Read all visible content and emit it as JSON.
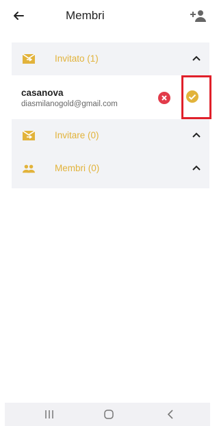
{
  "header": {
    "title": "Membri",
    "back_icon": "arrow-left-icon",
    "add_icon": "add-person-icon"
  },
  "sections": [
    {
      "label": "Invitato (1)",
      "icon": "mail-arrow-icon",
      "expanded": true
    },
    {
      "label": "Invitare (0)",
      "icon": "mail-forward-icon",
      "expanded": true
    },
    {
      "label": "Membri (0)",
      "icon": "people-icon",
      "expanded": true
    }
  ],
  "invited_members": [
    {
      "name": "casanova",
      "email": "diasmilanogold@gmail.com",
      "reject_icon": "close-circle-icon",
      "accept_icon": "check-circle-icon"
    }
  ],
  "navigation": {
    "recent_icon": "recent-apps-icon",
    "home_icon": "home-icon",
    "back_icon": "back-chevron-icon"
  },
  "colors": {
    "accent": "#e2b33b",
    "reject": "#e23b4a",
    "highlight": "#e0202a",
    "panel": "#f2f3f6"
  }
}
